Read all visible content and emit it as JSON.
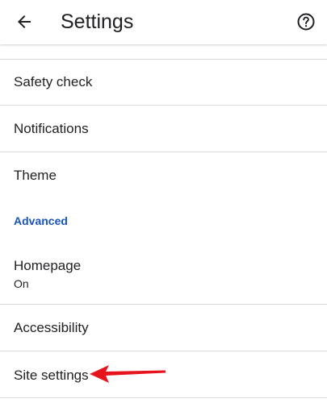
{
  "colors": {
    "accent": "#1a55b8",
    "annotation_arrow": "#e8141b",
    "divider": "#dadce0",
    "text": "#202124"
  },
  "toolbar": {
    "back_icon": "arrow-back-icon",
    "title": "Settings",
    "help_icon": "help-circle-icon"
  },
  "settings": {
    "safety_check": "Safety check",
    "notifications": "Notifications",
    "theme": "Theme",
    "advanced_header": "Advanced",
    "homepage": "Homepage",
    "homepage_value": "On",
    "accessibility": "Accessibility",
    "site_settings": "Site settings"
  },
  "annotation": {
    "icon": "red-arrow-pointer",
    "points_to": "Site settings"
  }
}
